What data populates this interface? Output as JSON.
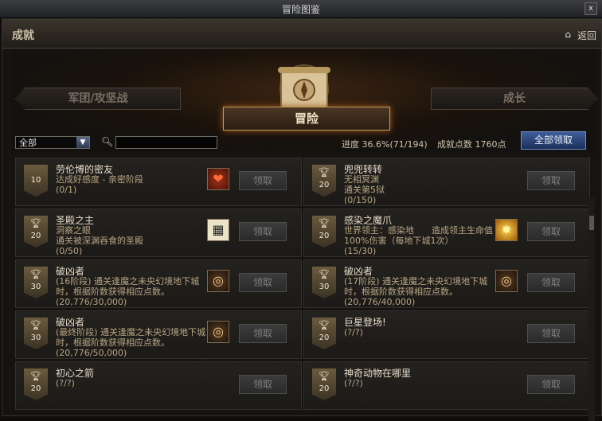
{
  "window": {
    "title": "冒险图鉴",
    "close": "x"
  },
  "header": {
    "section": "成就",
    "home_icon": "home-icon",
    "back": "返回",
    "back2": "返回"
  },
  "tabs": {
    "left": "军团/攻坚战",
    "center": "冒险",
    "right": "成长"
  },
  "filter": {
    "selected": "全部",
    "search_value": ""
  },
  "progress": {
    "label": "进度",
    "value": "36.6%(71/194)"
  },
  "points": {
    "label": "成就点数",
    "value": "1760点"
  },
  "claim_all": "全部领取",
  "claim_label": "领取",
  "left_items": [
    {
      "badge": "10",
      "title": "劳伦博的密友",
      "desc": "达成好感度 - 亲密阶段",
      "progress": "(0/1)",
      "icon": "heart-icon"
    },
    {
      "badge": "20",
      "title": "圣殿之主",
      "desc": "洞察之眼\n通关被深渊吞食的圣殿",
      "progress": "(0/50)",
      "icon": "map-icon"
    },
    {
      "badge": "30",
      "title": "破凶者",
      "desc": "(16阶段) 通关逢魔之未央幻境地下城时，根据阶数获得相应点数。",
      "progress": "(20,776/30,000)",
      "icon": "emblem-icon"
    },
    {
      "badge": "30",
      "title": "破凶者",
      "desc": "(最终阶段) 通关逢魔之未央幻境地下城时，根据阶数获得相应点数。",
      "progress": "(20,776/50,000)",
      "icon": "emblem-icon"
    },
    {
      "badge": "20",
      "title": "初心之箭",
      "desc": "",
      "progress": "(?/?)",
      "icon": ""
    }
  ],
  "right_items": [
    {
      "badge": "20",
      "title": "兜兜转转",
      "desc": "无相冥渊\n通关第5狱",
      "progress": "(0/150)",
      "icon": ""
    },
    {
      "badge": "20",
      "title": "感染之魔爪",
      "desc": "世界领主：感染地　　造成领主生命值100%伤害（每地下城1次）",
      "progress": "(15/30)",
      "icon": "sun-icon"
    },
    {
      "badge": "30",
      "title": "破凶者",
      "desc": "(17阶段) 通关逢魔之未央幻境地下城时，根据阶数获得相应点数。",
      "progress": "(20,776/40,000)",
      "icon": "emblem-icon"
    },
    {
      "badge": "20",
      "title": "巨星登场!",
      "desc": "",
      "progress": "(?/?)",
      "icon": ""
    },
    {
      "badge": "20",
      "title": "神奇动物在哪里",
      "desc": "",
      "progress": "(?/?)",
      "icon": ""
    }
  ]
}
